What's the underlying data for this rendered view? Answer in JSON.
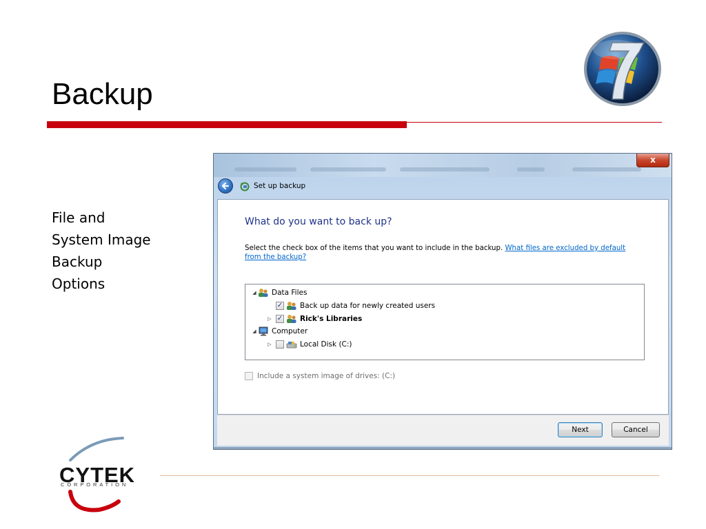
{
  "slide": {
    "title": "Backup",
    "side_text": [
      "File and",
      "System Image",
      "Backup",
      "Options"
    ],
    "logo_brand": "CYTEK",
    "logo_sub": "CORPORATION",
    "accent_color": "#c8000d"
  },
  "dialog": {
    "close_label": "x",
    "nav_title": "Set up backup",
    "heading": "What do you want to back up?",
    "description": "Select the check box of the items that you want to include in the backup.",
    "description_link": "What files are excluded by default from the backup?",
    "tree": [
      {
        "label": "Data Files",
        "expander": "◢",
        "checkbox": null,
        "icon": "users-icon",
        "bold": false
      },
      {
        "label": "Back up data for newly created users",
        "expander": "",
        "checkbox": true,
        "icon": "users-icon",
        "bold": false
      },
      {
        "label": "Rick's Libraries",
        "expander": "▷",
        "checkbox": true,
        "icon": "users-icon",
        "bold": true
      },
      {
        "label": "Computer",
        "expander": "◢",
        "checkbox": null,
        "icon": "computer-icon",
        "bold": false
      },
      {
        "label": "Local Disk (C:)",
        "expander": "▷",
        "checkbox": false,
        "icon": "drive-icon",
        "bold": false
      }
    ],
    "system_image_label": "Include a system image of drives: (C:)",
    "system_image_checked": false,
    "next_label": "Next",
    "cancel_label": "Cancel"
  }
}
